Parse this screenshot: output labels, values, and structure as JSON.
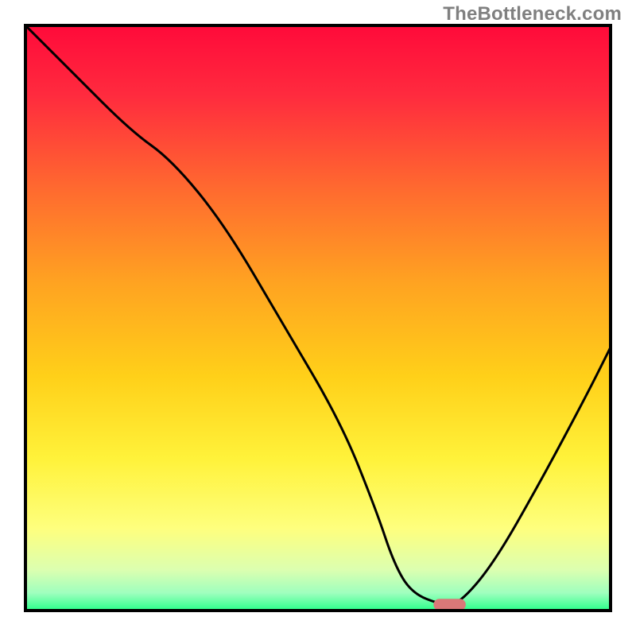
{
  "watermark": "TheBottleneck.com",
  "chart_data": {
    "type": "line",
    "title": "",
    "xlabel": "",
    "ylabel": "",
    "xlim": [
      0,
      100
    ],
    "ylim": [
      0,
      100
    ],
    "background": {
      "type": "vertical-gradient",
      "stops": [
        {
          "offset": 0.0,
          "color": "#ff0a3a"
        },
        {
          "offset": 0.12,
          "color": "#ff2b3e"
        },
        {
          "offset": 0.28,
          "color": "#ff6a2f"
        },
        {
          "offset": 0.44,
          "color": "#ffa321"
        },
        {
          "offset": 0.6,
          "color": "#ffd019"
        },
        {
          "offset": 0.74,
          "color": "#fff23a"
        },
        {
          "offset": 0.86,
          "color": "#feff7e"
        },
        {
          "offset": 0.93,
          "color": "#dcffb0"
        },
        {
          "offset": 0.97,
          "color": "#9fffbe"
        },
        {
          "offset": 1.0,
          "color": "#2aff8a"
        }
      ]
    },
    "series": [
      {
        "name": "bottleneck-curve",
        "color": "#000000",
        "width": 3,
        "x": [
          0,
          8,
          18,
          25,
          34,
          44,
          54,
          60,
          63,
          66,
          71,
          74,
          80,
          88,
          96,
          100
        ],
        "y": [
          100,
          92,
          82,
          77,
          66,
          49,
          32,
          17,
          8,
          3,
          1,
          1,
          8,
          22,
          37,
          45
        ]
      }
    ],
    "markers": [
      {
        "name": "optimal-pill",
        "shape": "rounded-rect",
        "cx": 72.5,
        "cy": 1.0,
        "width": 5.5,
        "height": 2.0,
        "color": "#d97878"
      }
    ],
    "axes": {
      "show_ticks": false,
      "frame_color": "#000000",
      "frame_width": 4
    }
  }
}
